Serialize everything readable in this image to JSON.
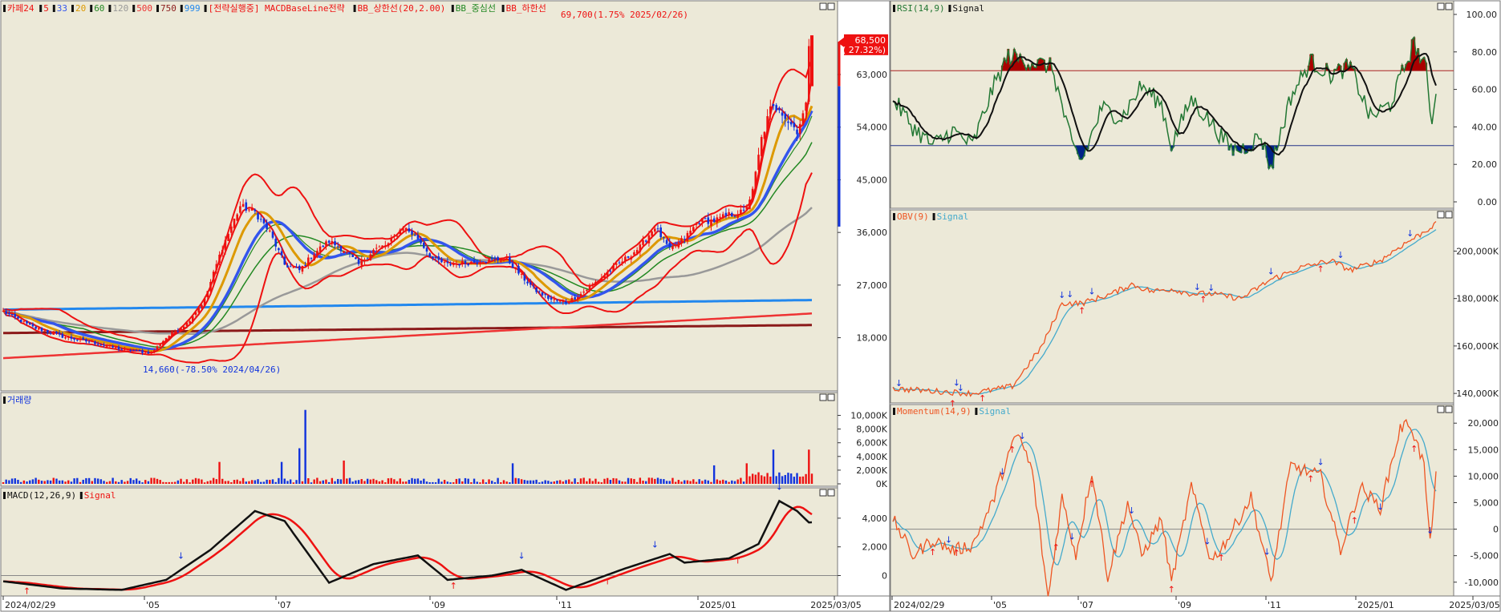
{
  "colors": {
    "panel_bg": "#ece9d8",
    "axis_bg": "#ffffff",
    "up": "#ee1111",
    "down": "#1133dd",
    "ma5": "#ee1111",
    "ma33": "#3355ee",
    "ma20": "#dd9900",
    "ma60": "#228822",
    "ma120": "#999999",
    "ma500": "#ee3333",
    "ma750": "#8b1a1a",
    "ma999": "#2288ee",
    "bb": "#ee1111",
    "rsi": "#227733",
    "rsi_fill_hi": "#aa0000",
    "rsi_fill_lo": "#002288",
    "signal": "#111111",
    "obv": "#ee5522",
    "obv_sig": "#44aacc"
  },
  "main_legend": [
    {
      "text": "카페24",
      "color": "#ee1111"
    },
    {
      "text": "5",
      "color": "#ee1111"
    },
    {
      "text": "33",
      "color": "#3355ee"
    },
    {
      "text": "20",
      "color": "#dd9900"
    },
    {
      "text": "60",
      "color": "#228822"
    },
    {
      "text": "120",
      "color": "#999999"
    },
    {
      "text": "500",
      "color": "#ee3333"
    },
    {
      "text": "750",
      "color": "#8b1a1a"
    },
    {
      "text": "999",
      "color": "#2288ee"
    },
    {
      "text": "[전략실행중] MACDBaseLine전략",
      "color": "#ee1111"
    },
    {
      "text": "BB_상한선(20,2.00)",
      "color": "#ee1111"
    },
    {
      "text": "BB_중심선",
      "color": "#228822"
    },
    {
      "text": "BB_하한선",
      "color": "#ee1111"
    }
  ],
  "max_annotation": "69,700(1.75% 2025/02/26)",
  "min_annotation": "14,660(-78.50% 2024/04/26)",
  "current_price_box": [
    "68,500",
    "( 27.32%)"
  ],
  "volume_title": "거래량",
  "macd_legend": [
    {
      "text": "MACD(12,26,9)",
      "color": "#111111"
    },
    {
      "text": "Signal",
      "color": "#ee1111"
    }
  ],
  "rsi_legend": [
    {
      "text": "RSI(14,9)",
      "color": "#227733"
    },
    {
      "text": "Signal",
      "color": "#111111"
    }
  ],
  "obv_legend": [
    {
      "text": "OBV(9)",
      "color": "#ee5522"
    },
    {
      "text": "Signal",
      "color": "#44aacc"
    }
  ],
  "mom_legend": [
    {
      "text": "Momentum(14,9)",
      "color": "#ee5522"
    },
    {
      "text": "Signal",
      "color": "#44aacc"
    }
  ],
  "chart_data": {
    "type": "candlestick",
    "title": "카페24",
    "x_labels_left": [
      "2024/02/29",
      "'05",
      "'07",
      "'09",
      "'11",
      "2025/01",
      "2025/03/05"
    ],
    "x_labels_right": [
      "2024/02/29",
      "'05",
      "'07",
      "'09",
      "'11",
      "2025/01",
      "2025/03/05"
    ],
    "price_axis": {
      "ticks": [
        "63,000",
        "54,000",
        "45,000",
        "36,000",
        "27,000",
        "18,000"
      ],
      "range": [
        10000,
        73000
      ]
    },
    "volume_axis": {
      "ticks": [
        "10,000K",
        "8,000K",
        "6,000K",
        "4,000K",
        "2,000K",
        "0K"
      ],
      "range": [
        0,
        11000
      ]
    },
    "macd_axis": {
      "ticks": [
        "4,000",
        "2,000",
        "0"
      ],
      "range": [
        -1200,
        5500
      ]
    },
    "rsi_axis": {
      "ticks": [
        "100.00",
        "80.00",
        "60.00",
        "40.00",
        "20.00",
        "0.00"
      ],
      "range": [
        0,
        100
      ],
      "levels": [
        70,
        30
      ]
    },
    "obv_axis": {
      "ticks": [
        "200,000K",
        "180,000K",
        "160,000K",
        "140,000K"
      ],
      "range": [
        137000,
        214000
      ]
    },
    "mom_axis": {
      "ticks": [
        "20,000",
        "15,000",
        "10,000",
        "5,000",
        "0",
        "-5,000",
        "-10,000"
      ],
      "range": [
        -12000,
        22000
      ]
    },
    "price_close_anchors": [
      [
        0,
        22500
      ],
      [
        10,
        19800
      ],
      [
        20,
        18200
      ],
      [
        30,
        17200
      ],
      [
        40,
        16000
      ],
      [
        50,
        15400
      ],
      [
        55,
        18000
      ],
      [
        62,
        20500
      ],
      [
        68,
        24500
      ],
      [
        74,
        33500
      ],
      [
        80,
        40500
      ],
      [
        85,
        39500
      ],
      [
        90,
        36000
      ],
      [
        95,
        30500
      ],
      [
        100,
        29500
      ],
      [
        105,
        32500
      ],
      [
        110,
        34500
      ],
      [
        115,
        33000
      ],
      [
        120,
        30500
      ],
      [
        125,
        33000
      ],
      [
        130,
        34000
      ],
      [
        135,
        37000
      ],
      [
        140,
        35000
      ],
      [
        145,
        31500
      ],
      [
        150,
        30500
      ],
      [
        160,
        31000
      ],
      [
        170,
        31500
      ],
      [
        175,
        28500
      ],
      [
        180,
        26000
      ],
      [
        185,
        24500
      ],
      [
        190,
        24000
      ],
      [
        195,
        25500
      ],
      [
        200,
        27500
      ],
      [
        205,
        29500
      ],
      [
        210,
        31500
      ],
      [
        215,
        33500
      ],
      [
        220,
        37000
      ],
      [
        225,
        33000
      ],
      [
        230,
        35000
      ],
      [
        235,
        38000
      ],
      [
        240,
        38000
      ],
      [
        245,
        39000
      ],
      [
        250,
        39500
      ],
      [
        253,
        43000
      ],
      [
        256,
        52000
      ],
      [
        259,
        57000
      ],
      [
        262,
        57500
      ],
      [
        265,
        55000
      ],
      [
        268,
        53500
      ],
      [
        271,
        57500
      ],
      [
        272,
        68500
      ]
    ],
    "volume_spikes": [
      [
        73,
        3200
      ],
      [
        94,
        3200
      ],
      [
        100,
        5200
      ],
      [
        102,
        10800
      ],
      [
        115,
        3400
      ],
      [
        172,
        3000
      ],
      [
        240,
        2700
      ],
      [
        251,
        3000
      ],
      [
        260,
        5000
      ],
      [
        272,
        5000
      ]
    ],
    "macd_anchors": [
      [
        0,
        -400
      ],
      [
        20,
        -900
      ],
      [
        40,
        -1000
      ],
      [
        55,
        -300
      ],
      [
        70,
        1800
      ],
      [
        85,
        4500
      ],
      [
        95,
        3800
      ],
      [
        110,
        -500
      ],
      [
        125,
        800
      ],
      [
        140,
        1400
      ],
      [
        150,
        -300
      ],
      [
        165,
        0
      ],
      [
        175,
        400
      ],
      [
        190,
        -1000
      ],
      [
        210,
        500
      ],
      [
        225,
        1500
      ],
      [
        230,
        900
      ],
      [
        245,
        1200
      ],
      [
        255,
        2200
      ],
      [
        262,
        5200
      ],
      [
        268,
        4500
      ],
      [
        272,
        3700
      ]
    ],
    "rsi_anchors": [
      [
        0,
        55
      ],
      [
        10,
        40
      ],
      [
        20,
        30
      ],
      [
        30,
        38
      ],
      [
        40,
        30
      ],
      [
        50,
        60
      ],
      [
        58,
        78
      ],
      [
        68,
        75
      ],
      [
        80,
        72
      ],
      [
        90,
        30
      ],
      [
        95,
        22
      ],
      [
        105,
        50
      ],
      [
        115,
        45
      ],
      [
        125,
        62
      ],
      [
        135,
        52
      ],
      [
        140,
        30
      ],
      [
        150,
        55
      ],
      [
        160,
        42
      ],
      [
        170,
        28
      ],
      [
        175,
        28
      ],
      [
        185,
        35
      ],
      [
        190,
        18
      ],
      [
        200,
        56
      ],
      [
        210,
        75
      ],
      [
        220,
        68
      ],
      [
        230,
        72
      ],
      [
        240,
        45
      ],
      [
        250,
        52
      ],
      [
        262,
        85
      ],
      [
        268,
        70
      ],
      [
        271,
        42
      ],
      [
        273,
        62
      ]
    ],
    "obv_anchors": [
      [
        0,
        142000
      ],
      [
        20,
        141000
      ],
      [
        40,
        140000
      ],
      [
        60,
        143000
      ],
      [
        75,
        160000
      ],
      [
        85,
        178000
      ],
      [
        95,
        178000
      ],
      [
        110,
        182000
      ],
      [
        120,
        186000
      ],
      [
        130,
        183000
      ],
      [
        140,
        184000
      ],
      [
        150,
        182000
      ],
      [
        160,
        182000
      ],
      [
        175,
        180000
      ],
      [
        190,
        188000
      ],
      [
        205,
        193000
      ],
      [
        220,
        196000
      ],
      [
        230,
        192000
      ],
      [
        245,
        196000
      ],
      [
        255,
        202000
      ],
      [
        265,
        207000
      ],
      [
        272,
        211000
      ]
    ],
    "mom_anchors": [
      [
        0,
        2000
      ],
      [
        10,
        -5000
      ],
      [
        20,
        -2000
      ],
      [
        30,
        -4000
      ],
      [
        40,
        -3000
      ],
      [
        50,
        5000
      ],
      [
        58,
        14000
      ],
      [
        63,
        18000
      ],
      [
        70,
        11000
      ],
      [
        78,
        -13000
      ],
      [
        85,
        6000
      ],
      [
        92,
        -5000
      ],
      [
        100,
        11000
      ],
      [
        108,
        -9000
      ],
      [
        118,
        5000
      ],
      [
        125,
        -5000
      ],
      [
        135,
        2000
      ],
      [
        140,
        -10000
      ],
      [
        150,
        8000
      ],
      [
        160,
        -6000
      ],
      [
        168,
        -2000
      ],
      [
        180,
        6000
      ],
      [
        190,
        -10000
      ],
      [
        200,
        12000
      ],
      [
        215,
        10000
      ],
      [
        225,
        -4000
      ],
      [
        235,
        8000
      ],
      [
        245,
        4000
      ],
      [
        255,
        19000
      ],
      [
        260,
        20000
      ],
      [
        267,
        12000
      ],
      [
        270,
        -3000
      ],
      [
        273,
        11000
      ]
    ]
  }
}
